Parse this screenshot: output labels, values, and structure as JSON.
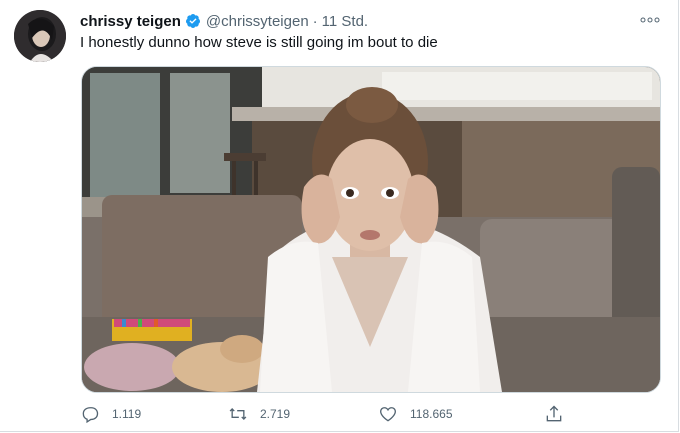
{
  "tweet": {
    "display_name": "chrissy teigen",
    "handle": "@chrissyteigen",
    "separator": "·",
    "time": "11 Std.",
    "text": "I honestly dunno how steve is still going im bout to die",
    "verified": true
  },
  "actions": {
    "reply_count": "1.119",
    "retweet_count": "2.719",
    "like_count": "118.665"
  },
  "colors": {
    "verified_blue": "#1d9bf0",
    "secondary_text": "#536471",
    "primary_text": "#0f1419"
  },
  "icons": {
    "more": "more-horizontal-icon",
    "reply": "reply-bubble-icon",
    "retweet": "retweet-arrows-icon",
    "like": "heart-outline-icon",
    "share": "share-upload-icon",
    "verified": "verified-badge-icon"
  }
}
